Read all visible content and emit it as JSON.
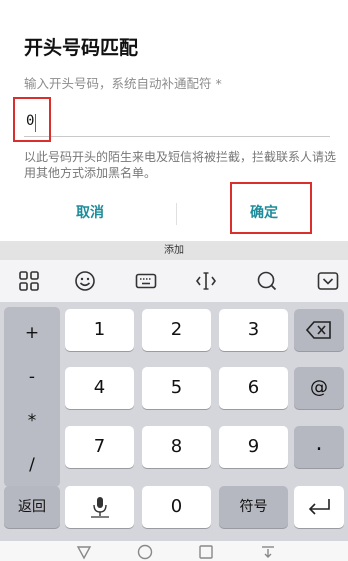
{
  "dialog": {
    "title": "开头号码匹配",
    "hint": "输入开头号码，系统自动补通配符 *",
    "input_value": "0",
    "description": "以此号码开头的陌生来电及短信将被拦截，拦截联系人请选用其他方式添加黑名单。",
    "cancel_label": "取消",
    "ok_label": "确定"
  },
  "keyboard": {
    "title": "添加",
    "symbols": [
      "+",
      "-",
      "*",
      "/"
    ],
    "digits": [
      "1",
      "2",
      "3",
      "4",
      "5",
      "6",
      "7",
      "8",
      "9"
    ],
    "zero": "0",
    "return_label": "返回",
    "symbols_label": "符号",
    "at": "@",
    "dot": "."
  },
  "icons": {
    "toolbar": [
      "grid-icon",
      "emoji-icon",
      "keyboard-icon",
      "cursor-icon",
      "search-icon",
      "collapse-icon"
    ],
    "backspace": "backspace-icon",
    "mic": "mic-icon",
    "enter": "enter-icon",
    "nav": [
      "back-icon",
      "home-icon",
      "recents-icon",
      "notification-icon"
    ]
  },
  "colors": {
    "accent": "#1e8c9a",
    "highlight": "#d9302d",
    "keyboard_bg": "#d5d6db"
  }
}
